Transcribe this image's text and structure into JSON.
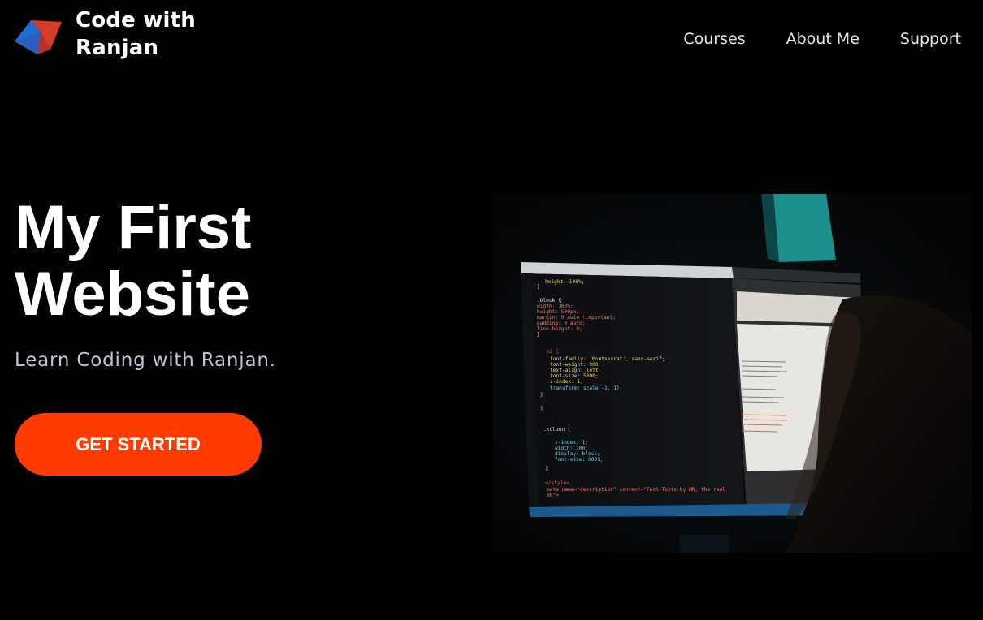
{
  "brand": {
    "name_line1": "Code with",
    "name_line2": "Ranjan",
    "logo_colors": [
      "#1f6fd1",
      "#d63c2a"
    ]
  },
  "nav": {
    "items": [
      {
        "label": "Courses"
      },
      {
        "label": "About Me"
      },
      {
        "label": "Support"
      }
    ]
  },
  "hero": {
    "title_line1": "My First",
    "title_line2": "Website",
    "subtitle": "Learn Coding with Ranjan.",
    "cta_label": "GET STARTED",
    "cta_color": "#ff3b00",
    "image_icon": "laptop-code-photo"
  },
  "colors": {
    "background": "#000000",
    "text": "#ffffff",
    "subtitle": "#bcc8d8"
  }
}
